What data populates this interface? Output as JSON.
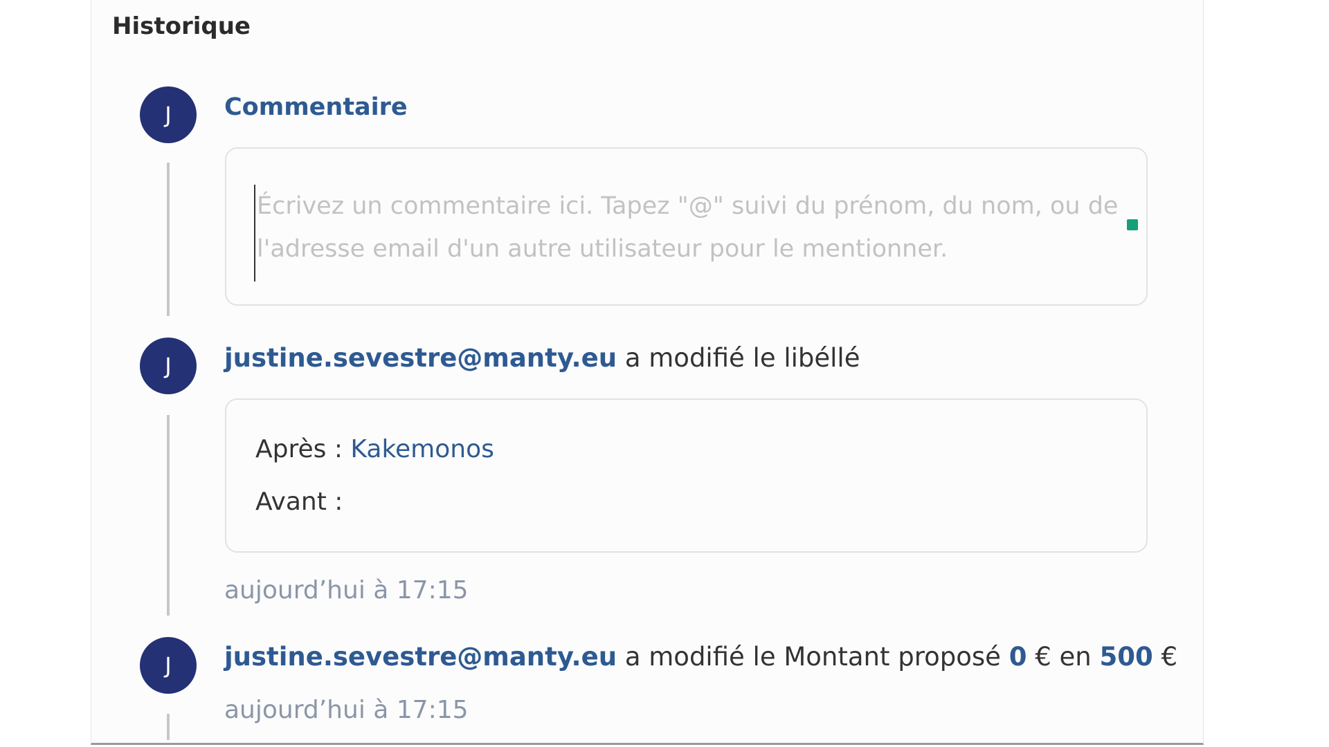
{
  "history": {
    "title": "Historique",
    "comment": {
      "avatar_initial": "J",
      "title": "Commentaire",
      "placeholder": "Écrivez un commentaire ici. Tapez \"@\" suivi du prénom, du nom, ou de l'adresse email d'un autre utilisateur pour le mentionner.",
      "value": ""
    },
    "entries": [
      {
        "avatar_initial": "J",
        "user": "justine.sevestre@manty.eu",
        "action": " a modifié le libéllé",
        "after_label": "Après : ",
        "after_value": "Kakemonos",
        "before_label": "Avant : ",
        "before_value": "",
        "timestamp": "aujourd’hui à 17:15"
      },
      {
        "avatar_initial": "J",
        "user": "justine.sevestre@manty.eu",
        "action": " a modifié le Montant proposé ",
        "from_value": "0",
        "currency_1": " € en ",
        "to_value": "500",
        "currency_2": " €",
        "timestamp": "aujourd’hui à 17:15"
      }
    ]
  },
  "colors": {
    "avatar": "#243174",
    "link": "#2e5a92",
    "timestamp": "#8a96a8",
    "status_dot": "#14a078"
  }
}
